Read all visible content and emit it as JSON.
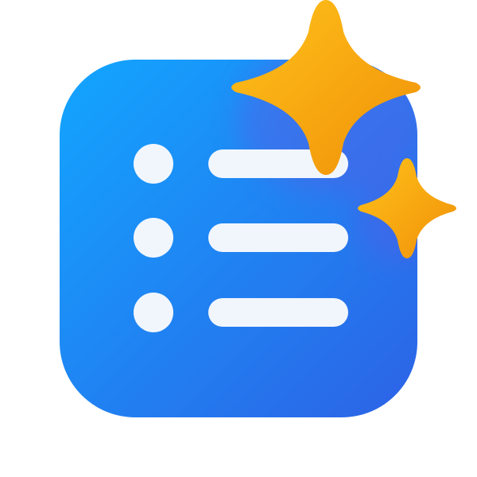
{
  "icon": {
    "name": "ai-list-sparkle-icon",
    "list_item_count": 3,
    "sparkle_count": 2,
    "colors": {
      "tile_gradient_start": "#12a6ff",
      "tile_gradient_end": "#2d62e6",
      "list_item": "#f1f6fd",
      "sparkle_gradient_start": "#ffc21a",
      "sparkle_gradient_end": "#f09008",
      "background": "#ffffff"
    }
  }
}
